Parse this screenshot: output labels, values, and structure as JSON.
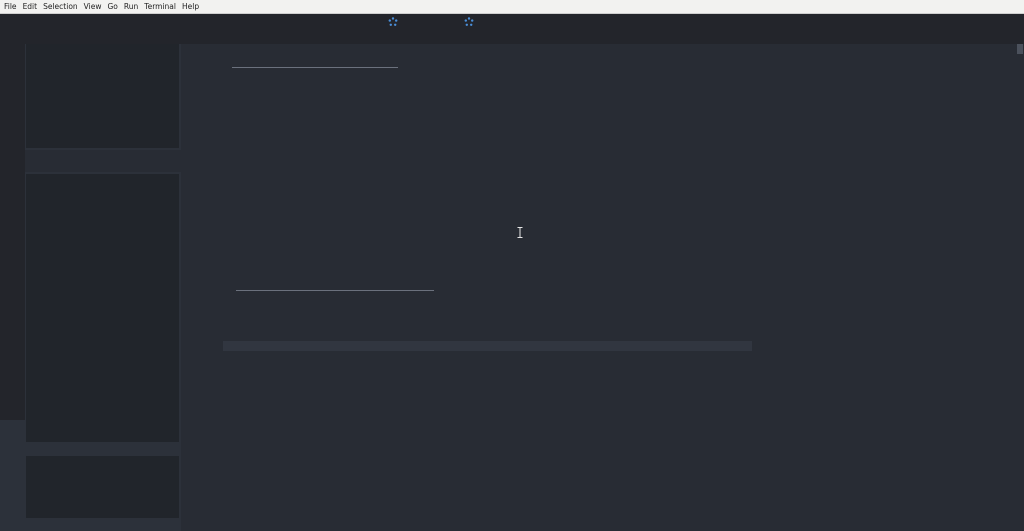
{
  "menubar": {
    "items": [
      {
        "label": "File"
      },
      {
        "label": "Edit"
      },
      {
        "label": "Selection"
      },
      {
        "label": "View"
      },
      {
        "label": "Go"
      },
      {
        "label": "Run"
      },
      {
        "label": "Terminal"
      },
      {
        "label": "Help"
      }
    ]
  },
  "icons": {
    "loading_left": "loading-spinner-icon",
    "loading_right": "loading-spinner-icon",
    "cursor": "text-cursor-icon"
  },
  "colors": {
    "menubar_bg": "#f2f2f0",
    "titlebar_bg": "#23252b",
    "editor_bg": "#282c34",
    "sidebar_panel_bg": "#21252b",
    "spinner_accent": "#4a8fd9"
  }
}
